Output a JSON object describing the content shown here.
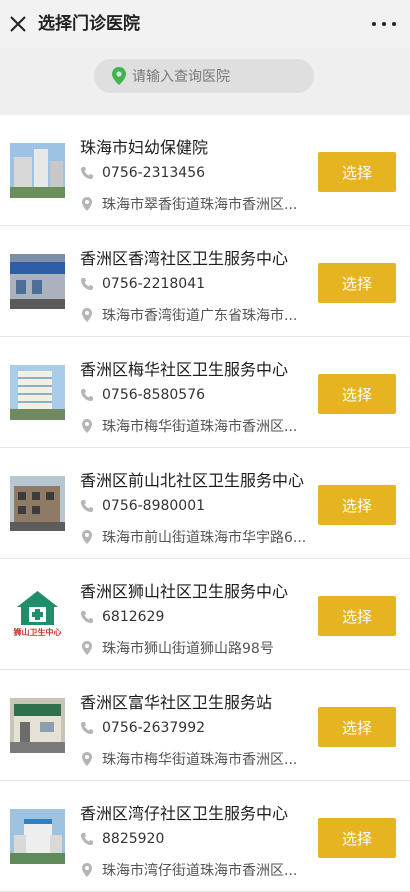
{
  "header": {
    "title": "选择门诊医院",
    "close_icon": "close-icon",
    "more_icon": "more-icon"
  },
  "search": {
    "placeholder": "请输入查询医院",
    "icon": "location-pin-icon",
    "icon_color": "#3fb550"
  },
  "colors": {
    "accent": "#e6b421",
    "background": "#efefef"
  },
  "hospitals": [
    {
      "name": "珠海市妇幼保健院",
      "phone": "0756-2313456",
      "address": "珠海市翠香街道珠海市香洲区...",
      "button": "选择"
    },
    {
      "name": "香洲区香湾社区卫生服务中心",
      "phone": "0756-2218041",
      "address": "珠海市香湾街道广东省珠海市...",
      "button": "选择"
    },
    {
      "name": "香洲区梅华社区卫生服务中心",
      "phone": "0756-8580576",
      "address": "珠海市梅华街道珠海市香洲区...",
      "button": "选择"
    },
    {
      "name": "香洲区前山北社区卫生服务中心",
      "phone": "0756-8980001",
      "address": "珠海市前山街道珠海市华宇路6...",
      "button": "选择"
    },
    {
      "name": "香洲区狮山社区卫生服务中心",
      "phone": "6812629",
      "address": "珠海市狮山街道狮山路98号",
      "button": "选择",
      "logo_text": "狮山卫生中心"
    },
    {
      "name": "香洲区富华社区卫生服务站",
      "phone": "0756-2637992",
      "address": "珠海市梅华街道珠海市香洲区...",
      "button": "选择"
    },
    {
      "name": "香洲区湾仔社区卫生服务中心",
      "phone": "8825920",
      "address": "珠海市湾仔街道珠海市香洲区...",
      "button": "选择"
    }
  ]
}
